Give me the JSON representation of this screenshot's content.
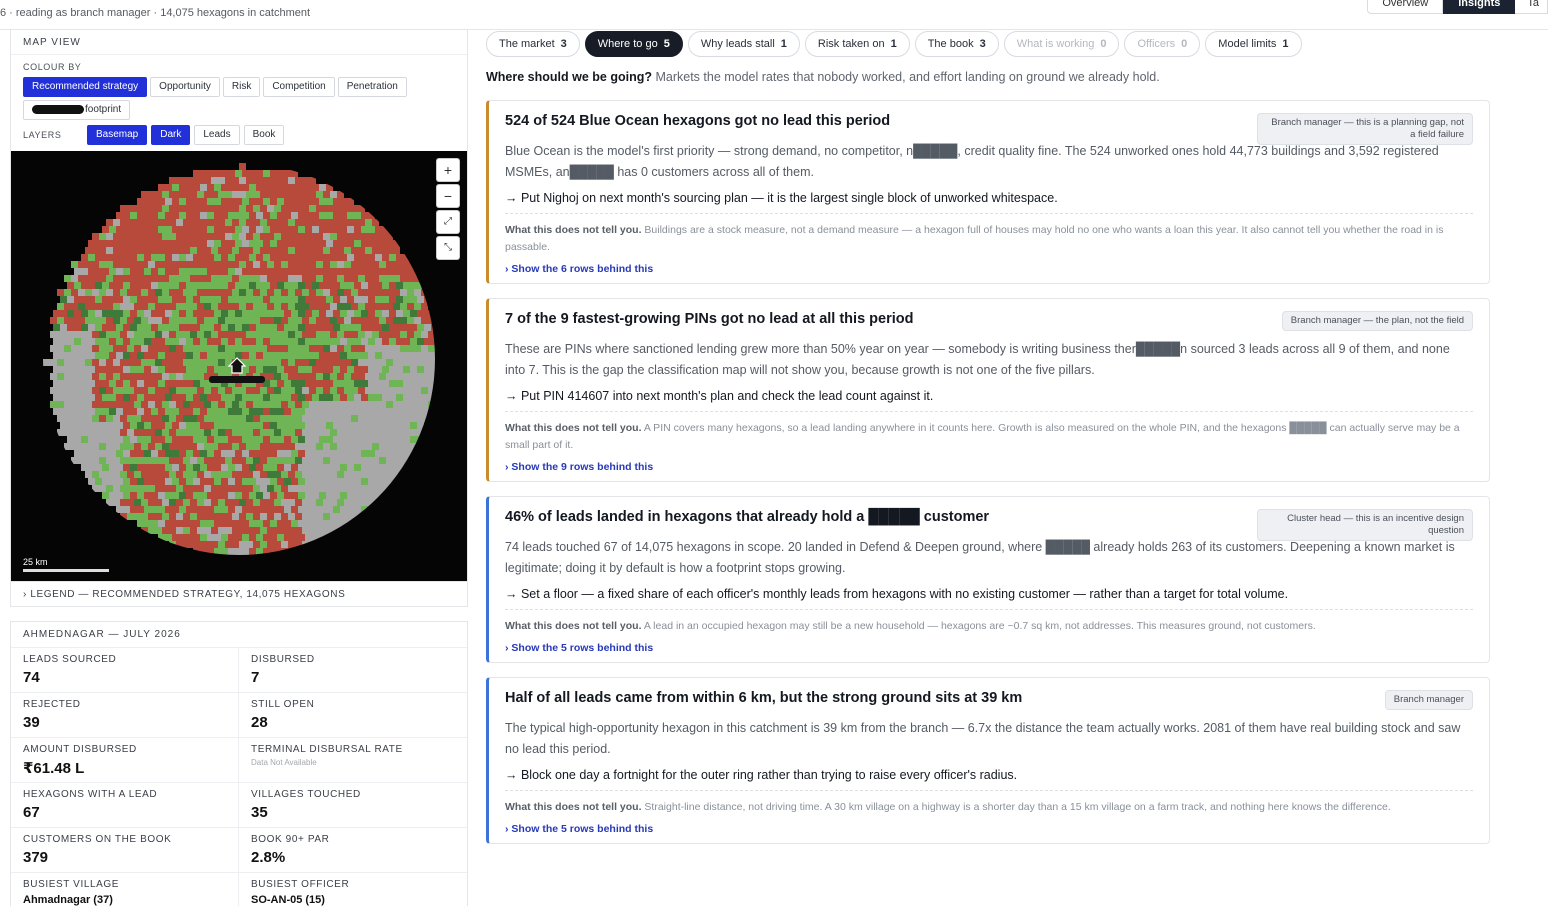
{
  "header": {
    "crumb": "6 · reading as branch manager · 14,075 hexagons in catchment",
    "view_tabs": [
      "Overview",
      "Insights",
      "Ta"
    ]
  },
  "map_panel": {
    "title": "MAP VIEW",
    "colour_by_label": "COLOUR BY",
    "colour_by_options": [
      "Recommended strategy",
      "Opportunity",
      "Risk",
      "Competition",
      "Penetration"
    ],
    "colour_by_extra": "footprint",
    "layers_label": "LAYERS",
    "layers": [
      "Basemap",
      "Dark",
      "Leads",
      "Book"
    ],
    "scale_label": "25 km",
    "legend_label": "LEGEND — RECOMMENDED STRATEGY, 14,075 HEXAGONS",
    "colors": {
      "defend": "#b84a3c",
      "grow": "#6fb556",
      "muted": "#a8a8a8",
      "deep_green": "#3f7a3a"
    }
  },
  "stats_panel": {
    "title": "AHMEDNAGAR — JULY 2026",
    "stats": [
      {
        "label": "LEADS SOURCED",
        "value": "74"
      },
      {
        "label": "DISBURSED",
        "value": "7"
      },
      {
        "label": "REJECTED",
        "value": "39"
      },
      {
        "label": "STILL OPEN",
        "value": "28"
      },
      {
        "label": "AMOUNT DISBURSED",
        "value": "₹61.48 L"
      },
      {
        "label": "TERMINAL DISBURSAL RATE",
        "value": "Data Not Available"
      },
      {
        "label": "HEXAGONS WITH A LEAD",
        "value": "67"
      },
      {
        "label": "VILLAGES TOUCHED",
        "value": "35"
      },
      {
        "label": "CUSTOMERS ON THE BOOK",
        "value": "379"
      },
      {
        "label": "BOOK 90+ PAR",
        "value": "2.8%"
      },
      {
        "label": "BUSIEST VILLAGE",
        "value": "Ahmadnagar (37)"
      },
      {
        "label": "BUSIEST OFFICER",
        "value": "SO-AN-05 (15)"
      }
    ]
  },
  "insight_tabs": [
    {
      "label": "The market",
      "count": "3"
    },
    {
      "label": "Where to go",
      "count": "5"
    },
    {
      "label": "Why leads stall",
      "count": "1"
    },
    {
      "label": "Risk taken on",
      "count": "1"
    },
    {
      "label": "The book",
      "count": "3"
    },
    {
      "label": "What is working",
      "count": "0"
    },
    {
      "label": "Officers",
      "count": "0"
    },
    {
      "label": "Model limits",
      "count": "1"
    }
  ],
  "intro": {
    "question": "Where should we be going?",
    "text": "Markets the model rates that nobody worked, and effort landing on ground we already hold."
  },
  "cards": [
    {
      "title": "524 of 524 Blue Ocean hexagons got no lead this period",
      "tag": "Branch manager — this is a planning gap, not a field failure",
      "body": "Blue Ocean is the model's first priority — strong demand, no competitor, n█████, credit quality fine. The 524 unworked ones hold 44,773 buildings and 3,592 registered MSMEs, an█████ has 0 customers across all of them.",
      "action": "→ Put Nighoj on next month's sourcing plan — it is the largest single block of unworked whitespace.",
      "caveat_head": "What this does not tell you.",
      "caveat": "Buildings are a stock measure, not a demand measure — a hexagon full of houses may hold no one who wants a loan this year. It also cannot tell you whether the road in is passable.",
      "rows": "› Show the 6 rows behind this"
    },
    {
      "title": "7 of the 9 fastest-growing PINs got no lead at all this period",
      "tag": "Branch manager — the plan, not the field",
      "body": "These are PINs where sanctioned lending grew more than 50% year on year — somebody is writing business ther█████n sourced 3 leads across all 9 of them, and none into 7. This is the gap the classification map will not show you, because growth is not one of the five pillars.",
      "action": "→ Put PIN 414607 into next month's plan and check the lead count against it.",
      "caveat_head": "What this does not tell you.",
      "caveat": "A PIN covers many hexagons, so a lead landing anywhere in it counts here. Growth is also measured on the whole PIN, and the hexagons █████ can actually serve may be a small part of it.",
      "rows": "› Show the 9 rows behind this"
    },
    {
      "title": "46% of leads landed in hexagons that already hold a █████ customer",
      "tag": "Cluster head — this is an incentive design question",
      "body": "74 leads touched 67 of 14,075 hexagons in scope. 20 landed in Defend & Deepen ground, where █████ already holds 263 of its customers. Deepening a known market is legitimate; doing it by default is how a footprint stops growing.",
      "action": "→ Set a floor — a fixed share of each officer's monthly leads from hexagons with no existing customer — rather than a target for total volume.",
      "caveat_head": "What this does not tell you.",
      "caveat": "A lead in an occupied hexagon may still be a new household — hexagons are ~0.7 sq km, not addresses. This measures ground, not customers.",
      "rows": "› Show the 5 rows behind this"
    },
    {
      "title": "Half of all leads came from within 6 km, but the strong ground sits at 39 km",
      "tag": "Branch manager",
      "body": "The typical high-opportunity hexagon in this catchment is 39 km from the branch — 6.7x the distance the team actually works. 2081 of them have real building stock and saw no lead this period.",
      "action": "→ Block one day a fortnight for the outer ring rather than trying to raise every officer's radius.",
      "caveat_head": "What this does not tell you.",
      "caveat": "Straight-line distance, not driving time. A 30 km village on a highway is a shorter day than a 15 km village on a farm track, and nothing here knows the difference.",
      "rows": "› Show the 5 rows behind this"
    }
  ]
}
